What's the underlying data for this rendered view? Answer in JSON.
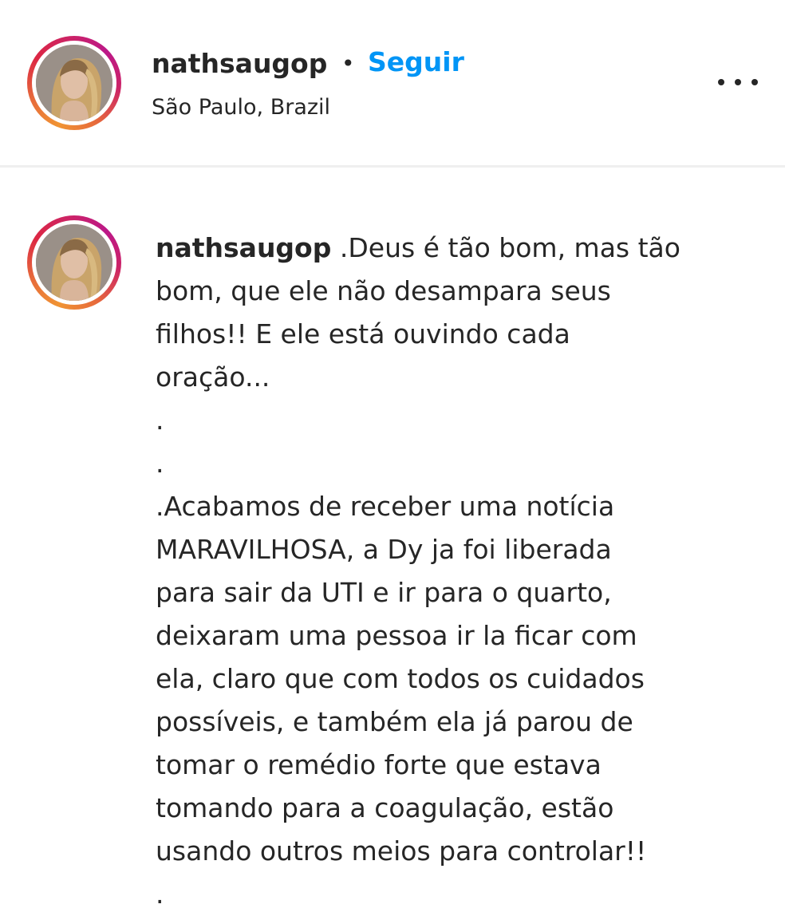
{
  "post": {
    "username": "nathsaugop",
    "separator": "•",
    "follow_label": "Seguir",
    "location": "São Paulo, Brazil",
    "avatar_icon": "profile-photo",
    "more_icon": "more-options-icon"
  },
  "comment": {
    "username": "nathsaugop",
    "lines": [
      ".Deus é tão bom, mas tão",
      "bom, que ele não desampara seus",
      "filhos!! E ele está ouvindo cada",
      "oração...",
      ".",
      ".",
      ".Acabamos de receber uma notícia",
      "MARAVILHOSA, a Dy ja foi liberada",
      "para sair da UTI e ir para o quarto,",
      "deixaram uma pessoa ir la ficar com",
      "ela, claro que com todos os cuidados",
      "possíveis, e também ela já parou de",
      "tomar o remédio forte que estava",
      "tomando para a coagulação, estão",
      "usando outros meios para controlar!!",
      "."
    ]
  },
  "colors": {
    "follow_blue": "#0095f6",
    "text": "#262626",
    "divider": "#efefef"
  }
}
